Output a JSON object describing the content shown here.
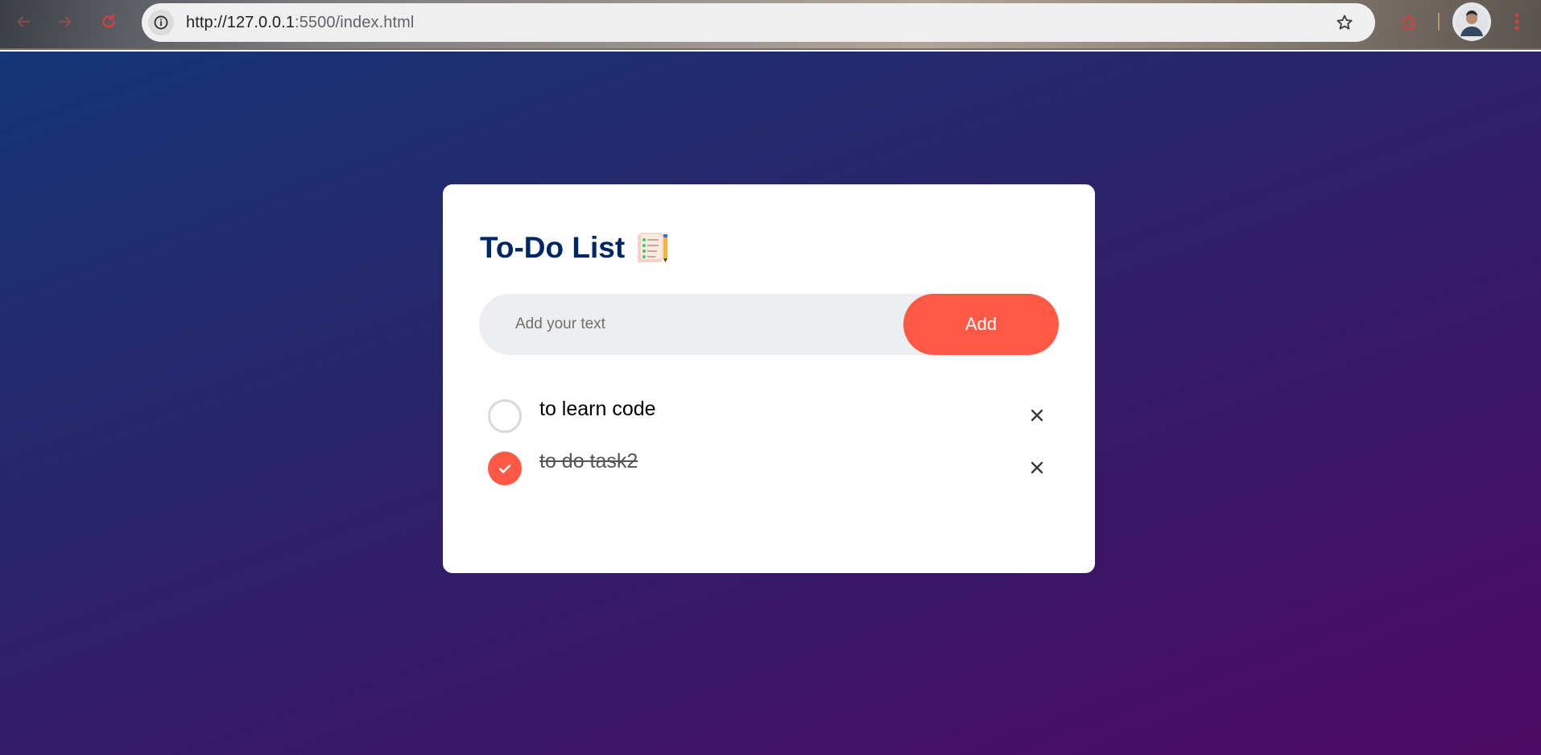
{
  "browser": {
    "url_host": "http://127.0.0.1",
    "url_rest": ":5500/index.html"
  },
  "app": {
    "title": "To-Do List",
    "input": {
      "placeholder": "Add your text",
      "value": ""
    },
    "add_label": "Add",
    "tasks": [
      {
        "text": "to learn code",
        "done": false
      },
      {
        "text": "to do task2",
        "done": true
      }
    ]
  },
  "colors": {
    "accent": "#ff5945",
    "title": "#002765",
    "input_bg": "#edeef0",
    "gradient_start": "#153677",
    "gradient_end": "#4e0a62"
  },
  "icons": {
    "back": "arrow-left-icon",
    "forward": "arrow-right-icon",
    "reload": "reload-icon",
    "site_info": "info-icon",
    "bookmark": "star-icon",
    "extension": "puzzle-icon",
    "menu": "kebab-menu-icon",
    "title_emoji": "notepad-icon",
    "delete": "close-icon",
    "checked": "check-icon"
  }
}
